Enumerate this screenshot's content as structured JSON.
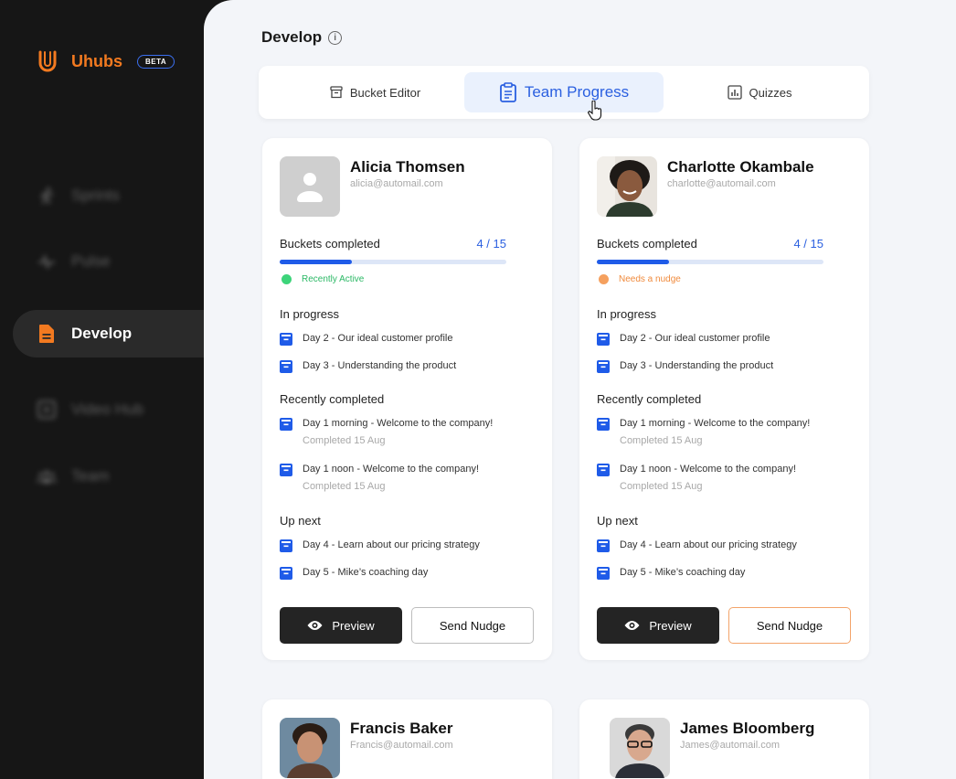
{
  "app": {
    "name": "Uhubs",
    "badge": "BETA"
  },
  "nav": [
    {
      "label": "Sprints",
      "icon": "runner-icon",
      "active": false
    },
    {
      "label": "Pulse",
      "icon": "pulse-icon",
      "active": false
    },
    {
      "label": "Develop",
      "icon": "document-icon",
      "active": true
    },
    {
      "label": "Video Hub",
      "icon": "play-icon",
      "active": false
    },
    {
      "label": "Team",
      "icon": "team-icon",
      "active": false
    }
  ],
  "page": {
    "title": "Develop"
  },
  "tabs": [
    {
      "label": "Bucket Editor",
      "icon": "archive-icon",
      "active": false
    },
    {
      "label": "Team Progress",
      "icon": "clipboard-icon",
      "active": true
    },
    {
      "label": "Quizzes",
      "icon": "chart-icon",
      "active": false
    }
  ],
  "labels": {
    "buckets_completed": "Buckets completed",
    "in_progress": "In progress",
    "recently_completed": "Recently completed",
    "up_next": "Up next",
    "preview": "Preview",
    "send_nudge": "Send Nudge"
  },
  "colors": {
    "accent": "#F37A20",
    "primary": "#1F5BE8",
    "active_green": "#3DD47A",
    "nudge_orange": "#F5A05E"
  },
  "members": [
    {
      "name": "Alicia Thomsen",
      "email": "alicia@automail.com",
      "buckets": "4 / 15",
      "progress_fraction": 0.32,
      "status": "Recently Active",
      "status_color": "#3DD47A",
      "status_text_color": "#2BB865",
      "in_progress": [
        "Day 2 - Our ideal customer profile",
        "Day 3 - Understanding the product"
      ],
      "recently_completed": [
        {
          "title": "Day 1 morning - Welcome to the company!",
          "date": "Completed 15 Aug"
        },
        {
          "title": "Day 1 noon - Welcome to the company!",
          "date": "Completed 15 Aug"
        }
      ],
      "up_next": [
        "Day 4 - Learn about our pricing strategy",
        "Day 5 - Mike’s coaching day"
      ]
    },
    {
      "name": "Charlotte Okambale",
      "email": "charlotte@automail.com",
      "buckets": "4 / 15",
      "progress_fraction": 0.32,
      "status": "Needs a nudge",
      "status_color": "#F5A05E",
      "status_text_color": "#F08A3C",
      "in_progress": [
        "Day 2 - Our ideal customer profile",
        "Day 3 - Understanding the product"
      ],
      "recently_completed": [
        {
          "title": "Day 1 morning - Welcome to the company!",
          "date": "Completed 15 Aug"
        },
        {
          "title": "Day 1 noon - Welcome to the company!",
          "date": "Completed 15 Aug"
        }
      ],
      "up_next": [
        "Day 4 - Learn about our pricing strategy",
        "Day 5 - Mike’s coaching day"
      ]
    },
    {
      "name": "Francis Baker",
      "email": "Francis@automail.com"
    },
    {
      "name": "James Bloomberg",
      "email": "James@automail.com"
    }
  ]
}
